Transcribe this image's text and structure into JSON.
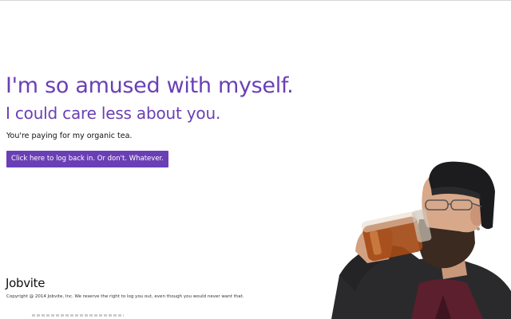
{
  "page": {
    "headline": "I'm so amused with myself.",
    "subheadline": "I could care less about you.",
    "tagline": "You're paying for my organic tea.",
    "login_button": "Click here to log back in. Or don't. Whatever."
  },
  "footer": {
    "logo": "Jobvite",
    "copyright": "Copyright @ 2014 Jobvite, Inc. We reserve the right to log you out, even though you would never want that."
  },
  "colors": {
    "accent": "#6a3fb5",
    "text": "#111111",
    "background": "#ffffff"
  },
  "image": {
    "subject": "man-drinking-tea-photo"
  }
}
